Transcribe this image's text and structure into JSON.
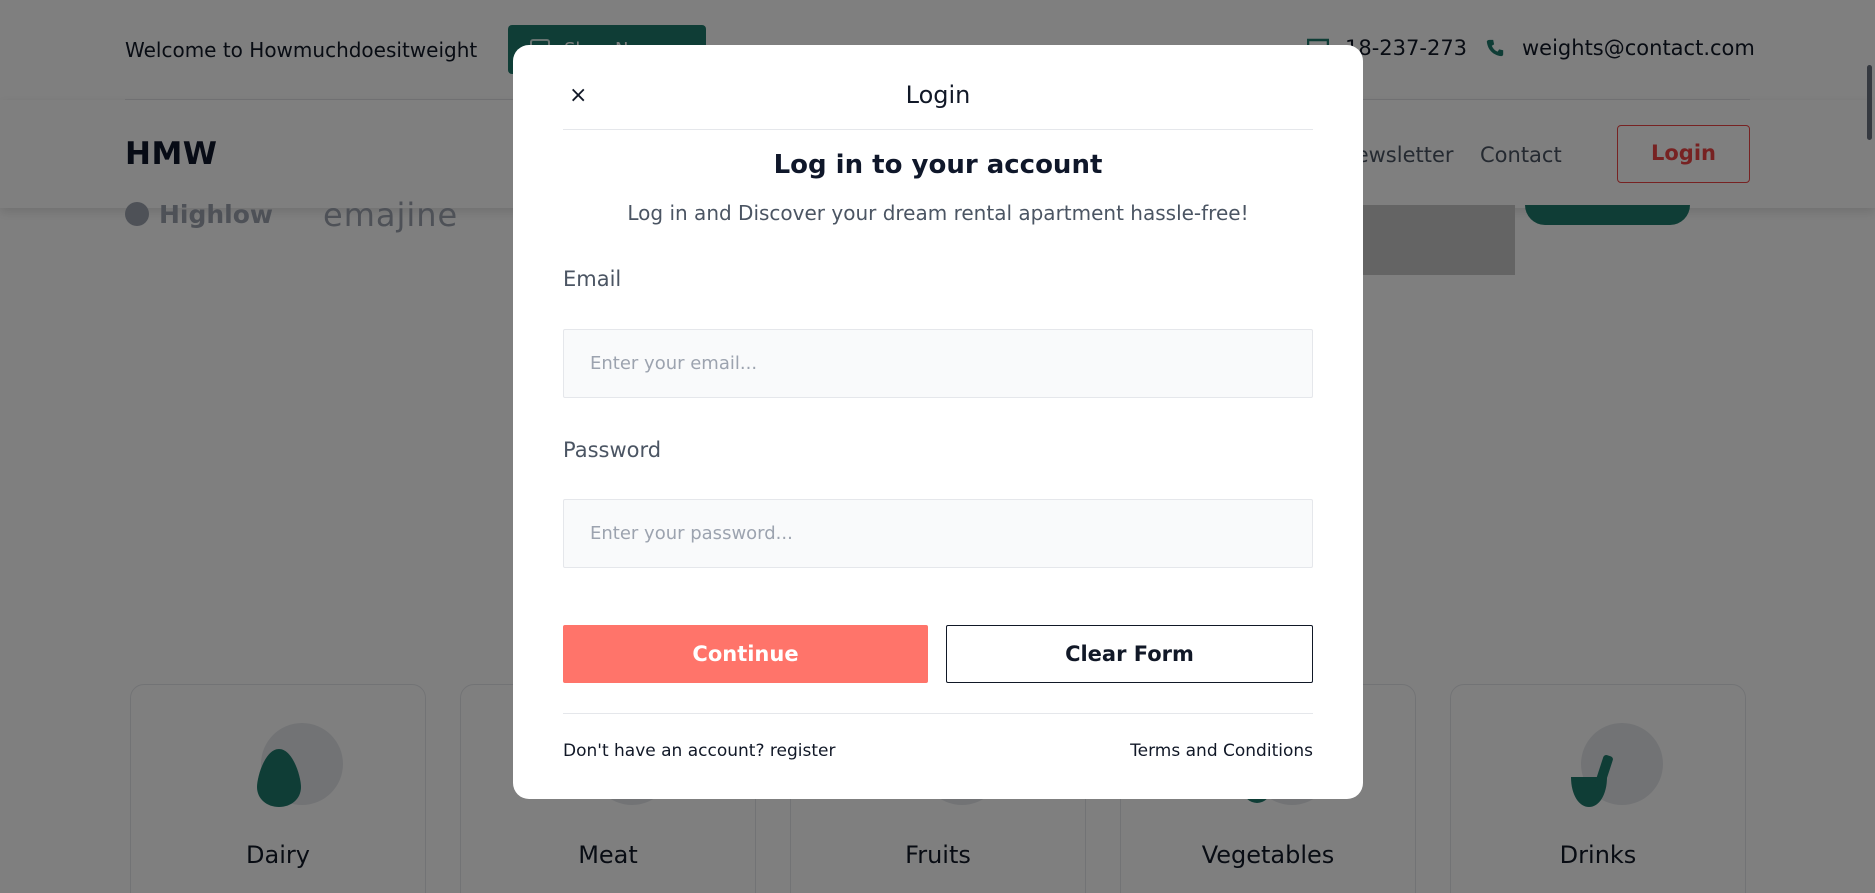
{
  "topbar": {
    "welcome": "Welcome to Howmuchdoesitweight",
    "shop_button": "Shop Now",
    "phone": "18-237-273",
    "email": "weights@contact.com"
  },
  "navbar": {
    "logo": "HMW",
    "links": [
      "Newsletter",
      "Contact"
    ],
    "login": "Login"
  },
  "brands": [
    "Highlow",
    "emajine"
  ],
  "categories": [
    {
      "label": "Dairy",
      "icon": "egg-icon"
    },
    {
      "label": "Meat",
      "icon": "meat-icon"
    },
    {
      "label": "Fruits",
      "icon": "fruit-icon"
    },
    {
      "label": "Vegetables",
      "icon": "vegetable-icon"
    },
    {
      "label": "Drinks",
      "icon": "drink-icon"
    }
  ],
  "modal": {
    "close_glyph": "×",
    "title": "Login",
    "heading": "Log in to your account",
    "subheading": "Log in and Discover your dream rental apartment hassle-free!",
    "email_label": "Email",
    "email_placeholder": "Enter your email...",
    "email_value": "",
    "password_label": "Password",
    "password_placeholder": "Enter your password...",
    "password_value": "",
    "continue_label": "Continue",
    "clear_label": "Clear Form",
    "register_text": "Don't have an account? register",
    "terms_text": "Terms and Conditions"
  },
  "colors": {
    "brand_green": "#1f7a6c",
    "accent_red": "#ef4444",
    "continue_bg": "#ff746a"
  }
}
